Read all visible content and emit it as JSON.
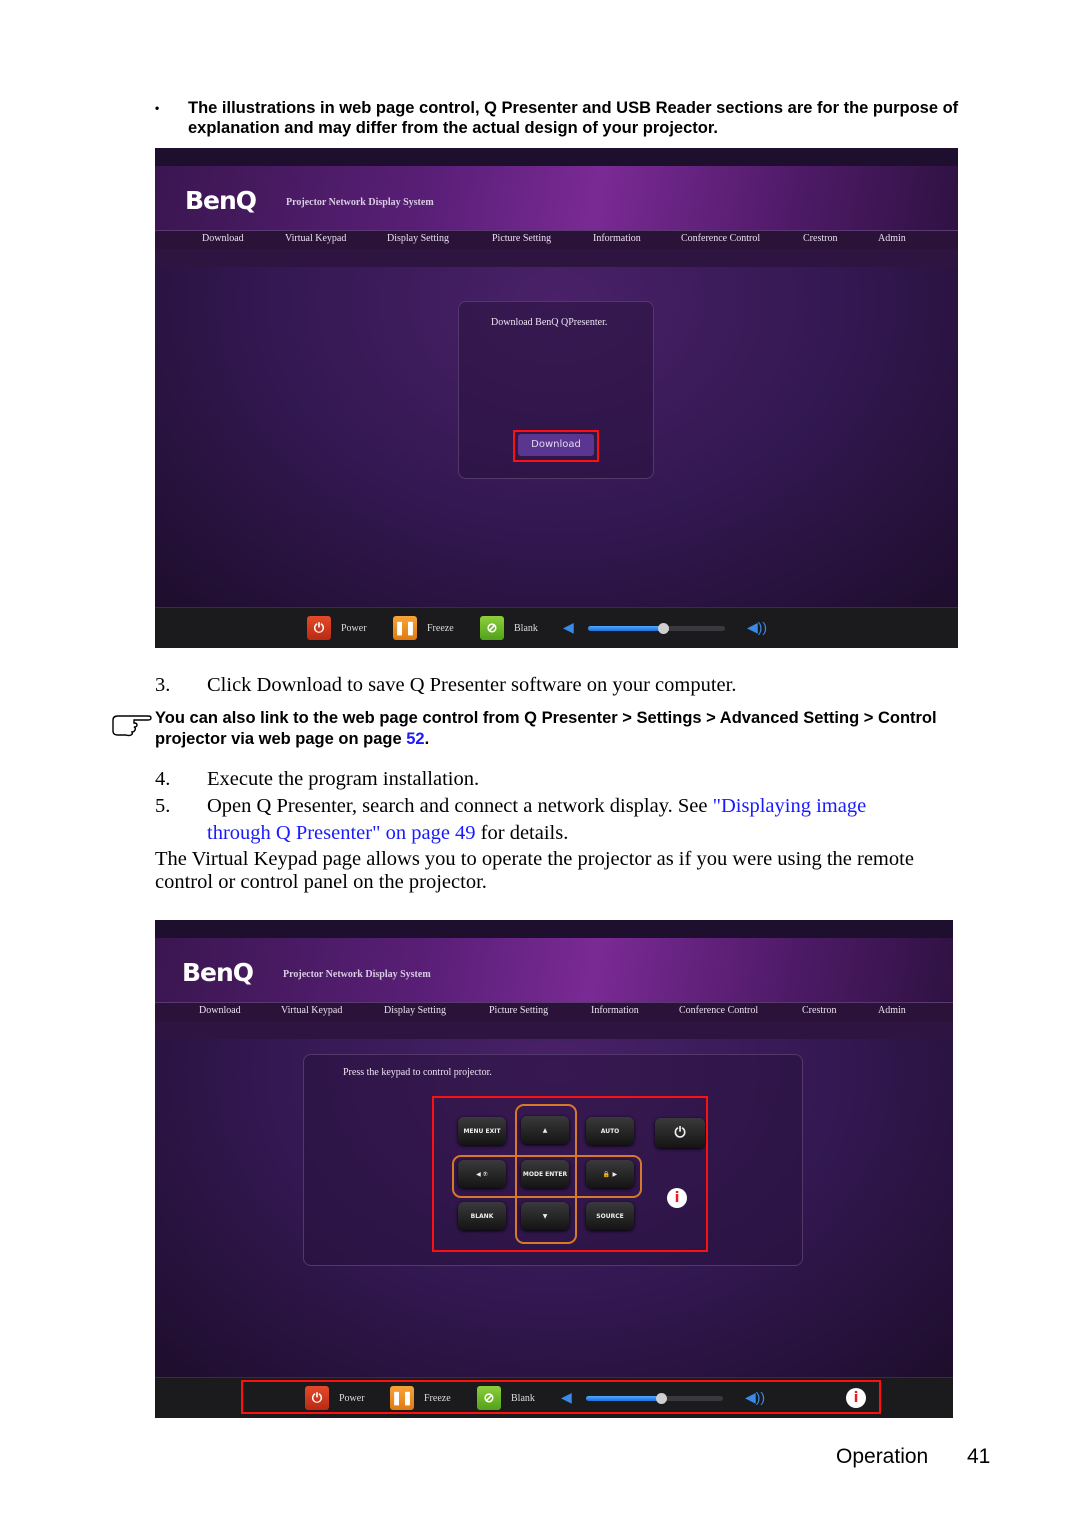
{
  "note": {
    "bullet": "•",
    "text": "The illustrations in web page control, Q Presenter and USB Reader sections are for the purpose of explanation and may differ from the actual design of your projector."
  },
  "webui": {
    "logo": "BenQ",
    "subtitle": "Projector Network Display System",
    "nav": [
      "Download",
      "Virtual Keypad",
      "Display Setting",
      "Picture Setting",
      "Information",
      "Conference Control",
      "Crestron",
      "Admin"
    ],
    "footer": {
      "power": "Power",
      "freeze": "Freeze",
      "blank": "Blank",
      "volume_level": 0.55
    }
  },
  "screenshot1": {
    "panel_text": "Download BenQ QPresenter.",
    "download_button": "Download",
    "volume_level": 0.55
  },
  "screenshot2": {
    "panel_text": "Press the keypad to control projector.",
    "keys": {
      "menu_exit": "MENU EXIT",
      "up": "▲",
      "auto": "AUTO",
      "power": "⏻",
      "left": "◀ ⑦",
      "mode_enter": "MODE ENTER",
      "right": "🔒 ▶",
      "blank": "BLANK",
      "down": "▼",
      "source": "SOURCE"
    },
    "info_marker": "i",
    "volume_level": 0.55
  },
  "steps": {
    "s3_num": "3.",
    "s3_text": "Click Download to save Q Presenter software on your computer.",
    "tip_text": "You can also link to the web page control from Q Presenter > Settings > Advanced Setting > Control projector via web page on page ",
    "tip_link": "52",
    "tip_end": ".",
    "s4_num": "4.",
    "s4_text": "Execute the program installation.",
    "s5_num": "5.",
    "s5_pre": "Open Q Presenter, search and connect a network display. See ",
    "s5_link": "\"Displaying image through Q Presenter\" on page 49",
    "s5_post": " for details."
  },
  "paragraph": "The Virtual Keypad page allows you to operate the projector as if you were using the remote control or control panel on the projector.",
  "page_footer": {
    "section": "Operation",
    "page": "41"
  },
  "colors": {
    "link": "#1a1aff",
    "highlight_box": "#ff1010",
    "header_purple": "#5a1f78"
  }
}
